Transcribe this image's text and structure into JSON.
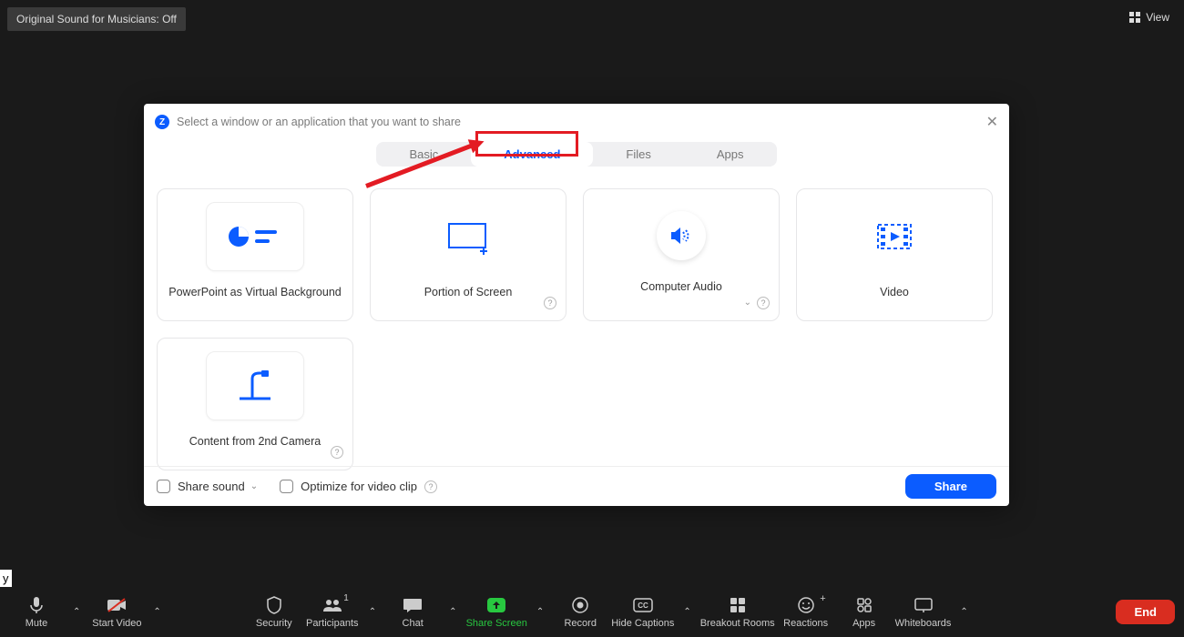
{
  "topbar": {
    "original_sound": "Original Sound for Musicians: Off",
    "view": "View"
  },
  "dialog": {
    "title": "Select a window or an application that you want to share",
    "tabs": {
      "basic": "Basic",
      "advanced": "Advanced",
      "files": "Files",
      "apps": "Apps"
    },
    "cards": {
      "ppt_vbg": "PowerPoint as Virtual Background",
      "portion": "Portion of Screen",
      "audio": "Computer Audio",
      "video": "Video",
      "second_cam": "Content from 2nd Camera"
    },
    "footer": {
      "share_sound": "Share sound",
      "optimize": "Optimize for video clip",
      "share_btn": "Share"
    }
  },
  "toolbar": {
    "mute": "Mute",
    "start_video": "Start Video",
    "security": "Security",
    "participants": "Participants",
    "participants_count": "1",
    "chat": "Chat",
    "share_screen": "Share Screen",
    "record": "Record",
    "hide_captions": "Hide Captions",
    "breakout": "Breakout Rooms",
    "reactions": "Reactions",
    "apps": "Apps",
    "whiteboards": "Whiteboards",
    "end": "End"
  }
}
